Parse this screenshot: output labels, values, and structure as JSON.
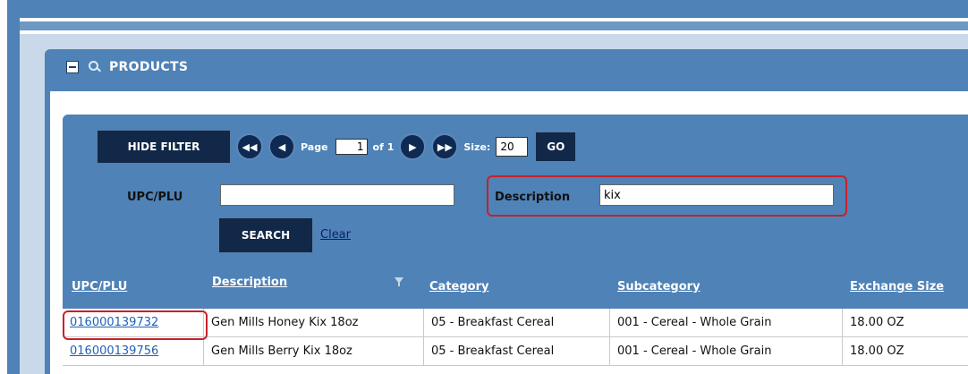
{
  "panel": {
    "title": "PRODUCTS"
  },
  "pager": {
    "hide_filter_label": "HIDE FILTER",
    "page_label": "Page",
    "page_value": "1",
    "of_label": "of 1",
    "size_label": "Size:",
    "size_value": "20",
    "go_label": "GO"
  },
  "filter": {
    "upc_label": "UPC/PLU",
    "upc_value": "",
    "description_label": "Description",
    "description_value": "kix",
    "search_label": "SEARCH",
    "clear_label": "Clear"
  },
  "table": {
    "columns": [
      "UPC/PLU",
      "Description",
      "Category",
      "Subcategory",
      "Exchange Size"
    ],
    "rows": [
      [
        "016000139732",
        "Gen Mills Honey Kix 18oz",
        "05 - Breakfast Cereal",
        "001 - Cereal - Whole Grain",
        "18.00 OZ"
      ],
      [
        "016000139756",
        "Gen Mills Berry Kix 18oz",
        "05 - Breakfast Cereal",
        "001 - Cereal - Whole Grain",
        "18.00 OZ"
      ]
    ]
  },
  "colors": {
    "frame": "#4f82b6",
    "button": "#122848",
    "highlight": "#c8202a",
    "link": "#1e62b8"
  }
}
